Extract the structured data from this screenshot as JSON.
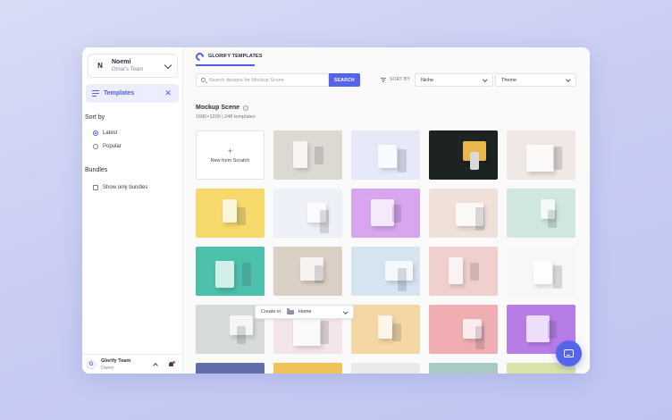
{
  "sidebar": {
    "team": {
      "initial": "N",
      "name": "Noemi",
      "subtitle": "Omar's Team"
    },
    "nav_templates": {
      "label": "Templates",
      "close": "✕"
    },
    "sort": {
      "title": "Sort by",
      "options": [
        {
          "label": "Latest",
          "selected": true
        },
        {
          "label": "Popular",
          "selected": false
        }
      ]
    },
    "bundles": {
      "title": "Bundles",
      "checkbox_label": "Show only bundles"
    },
    "footer": {
      "logo": "G",
      "title": "Glorify Team",
      "role": "Owner"
    }
  },
  "header": {
    "tab_label": "GLORIFY TEMPLATES"
  },
  "search": {
    "placeholder": "Search designs for Mockup Scene",
    "value": "",
    "button": "SEARCH"
  },
  "filters": {
    "sort_label": "SORT BY",
    "niche": {
      "value": "Niche"
    },
    "theme": {
      "value": "Theme"
    }
  },
  "section": {
    "title": "Mockup Scene",
    "info": "i",
    "meta": "1680×1200 | 248 templates"
  },
  "grid": {
    "scratch": {
      "plus": "+",
      "label": "New from Scratch"
    },
    "thumbnails": [
      {
        "subject": "packaging-mug",
        "bg": "#dcd8d2"
      },
      {
        "subject": "phone-bottle-wave",
        "bg": "#e6e9f7"
      },
      {
        "subject": "bottles-flatlay-dark",
        "bg": "#1c2321"
      },
      {
        "subject": "wine-glasses-flowers",
        "bg": "#efe7e3"
      },
      {
        "subject": "milk-bottle-yellow",
        "bg": "#f6d86b"
      },
      {
        "subject": "laptop-desk",
        "bg": "#eef0f8"
      },
      {
        "subject": "water-bottle-purple",
        "bg": "#d7a6ef"
      },
      {
        "subject": "cosmetic-bottles-pink",
        "bg": "#efe1d9"
      },
      {
        "subject": "juice-bottles-mint",
        "bg": "#cfe7df"
      },
      {
        "subject": "hands-teal",
        "bg": "#4cc0aa"
      },
      {
        "subject": "wine-monitor",
        "bg": "#d9cfc4"
      },
      {
        "subject": "books-stack",
        "bg": "#d6e4f2"
      },
      {
        "subject": "pink-bag-boxes",
        "bg": "#f0cfcf"
      },
      {
        "subject": "cosmetics-white",
        "bg": "#f7f7f7"
      },
      {
        "subject": "cards-leaves",
        "bg": "#d7dada"
      },
      {
        "subject": "tablet-phone-pink",
        "bg": "#f4e5ea"
      },
      {
        "subject": "magazine-orange",
        "bg": "#f5d7a6"
      },
      {
        "subject": "brochures-pink",
        "bg": "#f0aeb3"
      },
      {
        "subject": "purple-cards",
        "bg": "#b77de6"
      },
      {
        "subject": "row6-a",
        "bg": "#5f6dab"
      },
      {
        "subject": "row6-b",
        "bg": "#f0c25a"
      },
      {
        "subject": "row6-c",
        "bg": "#eaeaea"
      },
      {
        "subject": "row6-d",
        "bg": "#a9c9c4"
      },
      {
        "subject": "row6-e",
        "bg": "#d9e3a6"
      }
    ]
  },
  "create_in": {
    "label": "Create in:",
    "value": "Home"
  },
  "colors": {
    "accent": "#5565ea",
    "accent_soft": "#eceefd"
  }
}
